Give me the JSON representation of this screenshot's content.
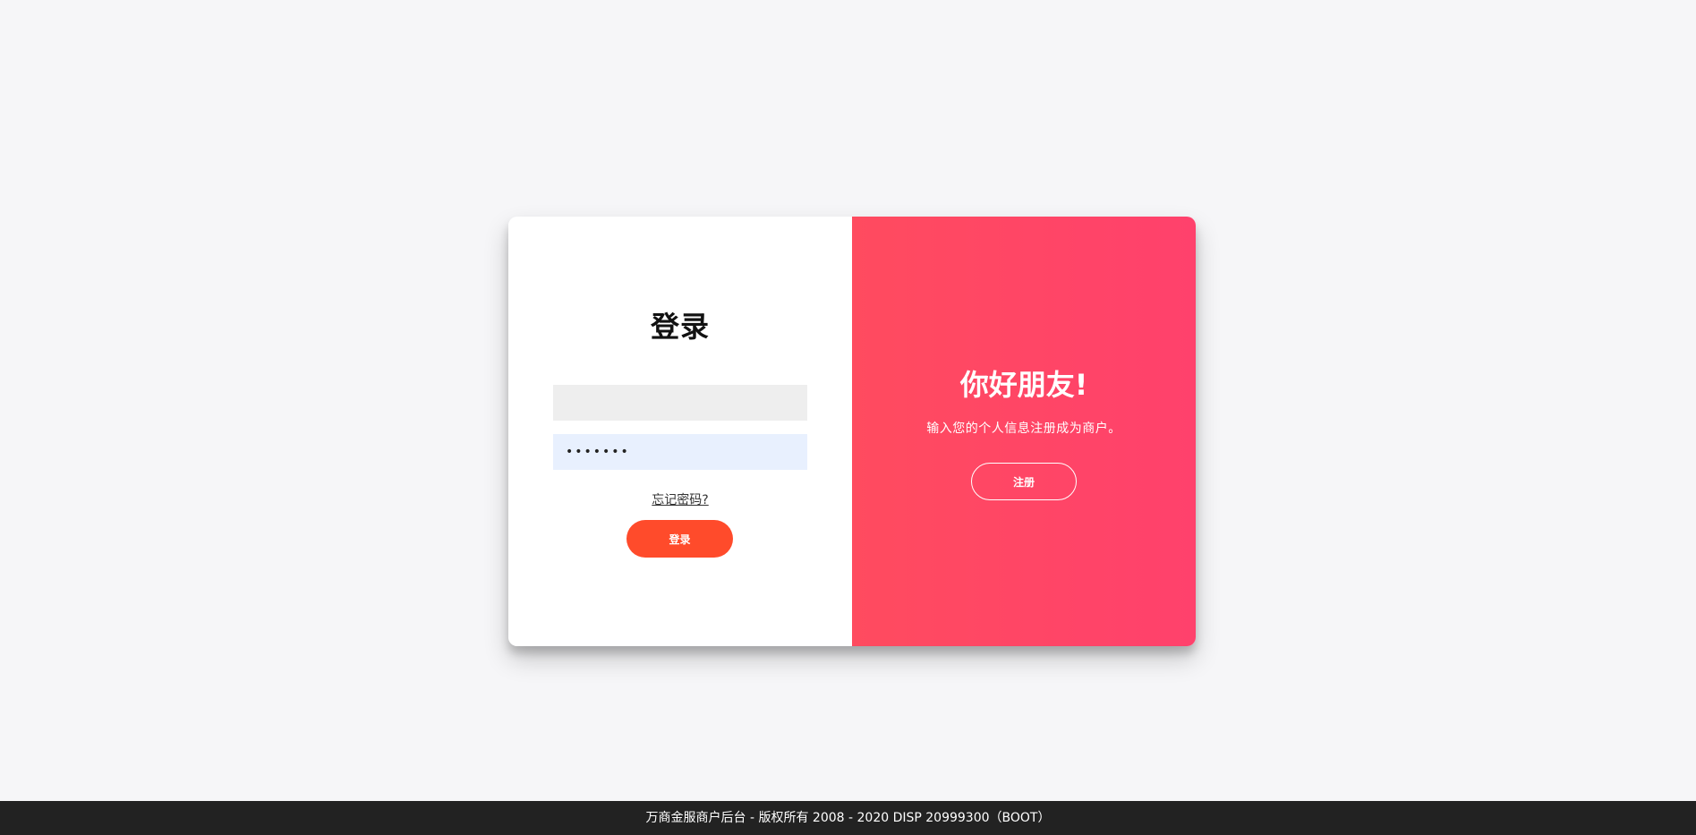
{
  "login": {
    "title": "登录",
    "username_value": "",
    "password_value": "•••••••",
    "forgot_label": "忘记密码?",
    "login_label": "登录"
  },
  "overlay": {
    "title": "你好朋友!",
    "text": "输入您的个人信息注册成为商户。",
    "signup_label": "注册"
  },
  "footer": {
    "text": "万商金服商户后台 - 版权所有 2008 - 2020 DISP 20999300（BOOT）"
  },
  "colors": {
    "accent": "#ff4b2b",
    "overlay_start": "#ff4b5f",
    "overlay_end": "#ff416c",
    "footer_bg": "#222222"
  }
}
